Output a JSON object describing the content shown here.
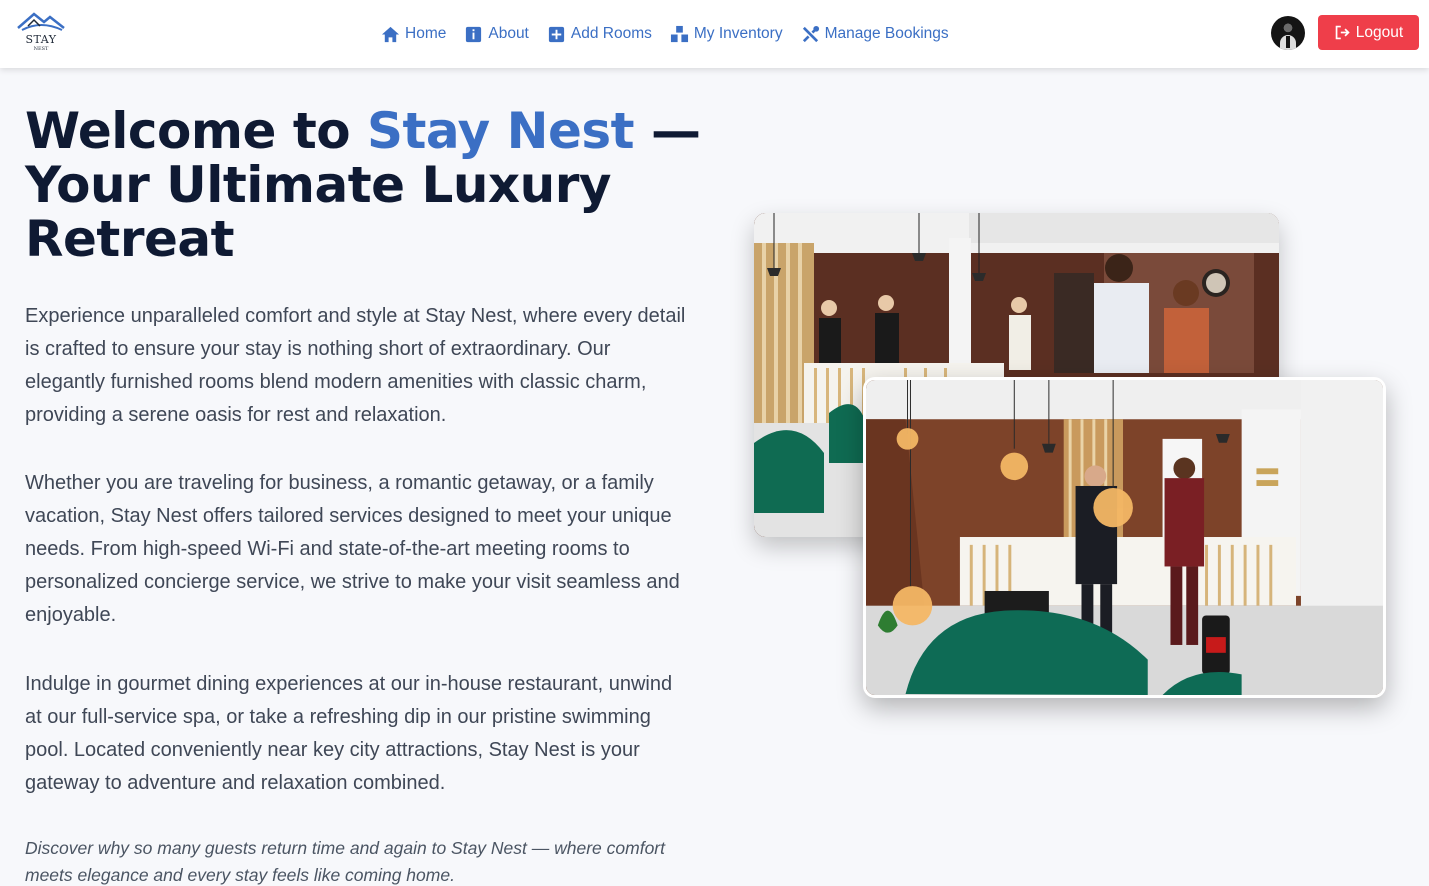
{
  "brand": {
    "logo_line1": "STAY",
    "logo_line2": "NEST",
    "logo_icon": "roof-logo"
  },
  "nav": {
    "items": [
      {
        "label": "Home",
        "icon": "home-icon"
      },
      {
        "label": "About",
        "icon": "info-icon"
      },
      {
        "label": "Add Rooms",
        "icon": "plus-square-icon"
      },
      {
        "label": "My Inventory",
        "icon": "boxes-icon"
      },
      {
        "label": "Manage Bookings",
        "icon": "tools-icon"
      }
    ],
    "logout_label": "Logout"
  },
  "hero": {
    "title_prefix": "Welcome to ",
    "title_brand": "Stay Nest",
    "title_suffix": " — Your Ultimate Luxury Retreat",
    "paragraphs": [
      "Experience unparalleled comfort and style at Stay Nest, where every detail is crafted to ensure your stay is nothing short of extraordinary. Our elegantly furnished rooms blend modern amenities with classic charm, providing a serene oasis for rest and relaxation.",
      "Whether you are traveling for business, a romantic getaway, or a family vacation, Stay Nest offers tailored services designed to meet your unique needs. From high-speed Wi-Fi and state-of-the-art meeting rooms to personalized concierge service, we strive to make your visit seamless and enjoyable.",
      "Indulge in gourmet dining experiences at our in-house restaurant, unwind at our full-service spa, or take a refreshing dip in our pristine swimming pool. Located conveniently near key city attractions, Stay Nest is your gateway to adventure and relaxation combined."
    ],
    "quote": "Discover why so many guests return time and again to Stay Nest — where comfort meets elegance and every stay feels like coming home."
  },
  "colors": {
    "accent": "#3b6fc4",
    "title": "#0f1a33",
    "logout": "#ef3e4a",
    "background": "#f7f8fb"
  }
}
